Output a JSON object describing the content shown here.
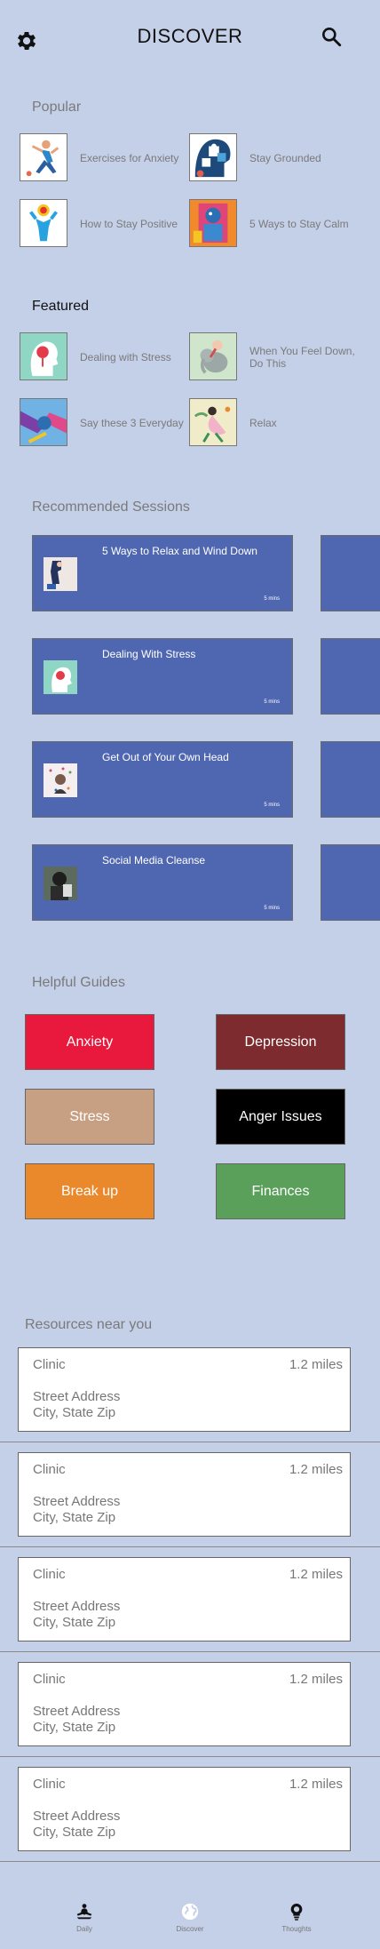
{
  "header": {
    "title": "DISCOVER",
    "settings_icon": "gear-icon",
    "search_icon": "search-icon"
  },
  "popular": {
    "title": "Popular",
    "items": [
      {
        "label": "Exercises for Anxiety",
        "icon": "runner-illustration"
      },
      {
        "label": "Stay Grounded",
        "icon": "puzzle-head-illustration"
      },
      {
        "label": "How to Stay Positive",
        "icon": "sun-figure-illustration"
      },
      {
        "label": "5 Ways to Stay Calm",
        "icon": "colorful-figure-illustration"
      }
    ]
  },
  "featured": {
    "title": "Featured",
    "items": [
      {
        "label": "Dealing with Stress",
        "icon": "head-heart-illustration"
      },
      {
        "label": "When You Feel Down, Do This",
        "icon": "elephant-illustration"
      },
      {
        "label": "Say these 3 Everyday",
        "icon": "hands-illustration"
      },
      {
        "label": "Relax",
        "icon": "dancer-illustration"
      }
    ]
  },
  "sessions": {
    "title": "Recommended Sessions",
    "items": [
      {
        "title": "5 Ways to Relax and Wind Down",
        "meta": "5 mins"
      },
      {
        "title": "Dealing With Stress",
        "meta": "5 mins"
      },
      {
        "title": "Get Out of Your Own Head",
        "meta": "5 mins"
      },
      {
        "title": "Social Media Cleanse",
        "meta": "5 mins"
      }
    ]
  },
  "guides": {
    "title": "Helpful Guides",
    "items": [
      {
        "label": "Anxiety",
        "color": "#e8193c"
      },
      {
        "label": "Depression",
        "color": "#7e2b2f"
      },
      {
        "label": "Stress",
        "color": "#c7a083"
      },
      {
        "label": "Anger Issues",
        "color": "#000000"
      },
      {
        "label": "Break up",
        "color": "#e9892c"
      },
      {
        "label": "Finances",
        "color": "#5aa05a"
      }
    ]
  },
  "resources": {
    "title": "Resources near you",
    "items": [
      {
        "name": "Clinic",
        "distance": "1.2 miles",
        "street": "Street Address",
        "city": "City, State Zip"
      },
      {
        "name": "Clinic",
        "distance": "1.2 miles",
        "street": "Street Address",
        "city": "City, State Zip"
      },
      {
        "name": "Clinic",
        "distance": "1.2 miles",
        "street": "Street Address",
        "city": "City, State Zip"
      },
      {
        "name": "Clinic",
        "distance": "1.2 miles",
        "street": "Street Address",
        "city": "City, State Zip"
      },
      {
        "name": "Clinic",
        "distance": "1.2 miles",
        "street": "Street Address",
        "city": "City, State Zip"
      }
    ]
  },
  "nav": {
    "items": [
      {
        "label": "Daily",
        "icon": "meditation-icon"
      },
      {
        "label": "Discover",
        "icon": "globe-icon"
      },
      {
        "label": "Thoughts",
        "icon": "lightbulb-icon"
      }
    ]
  }
}
